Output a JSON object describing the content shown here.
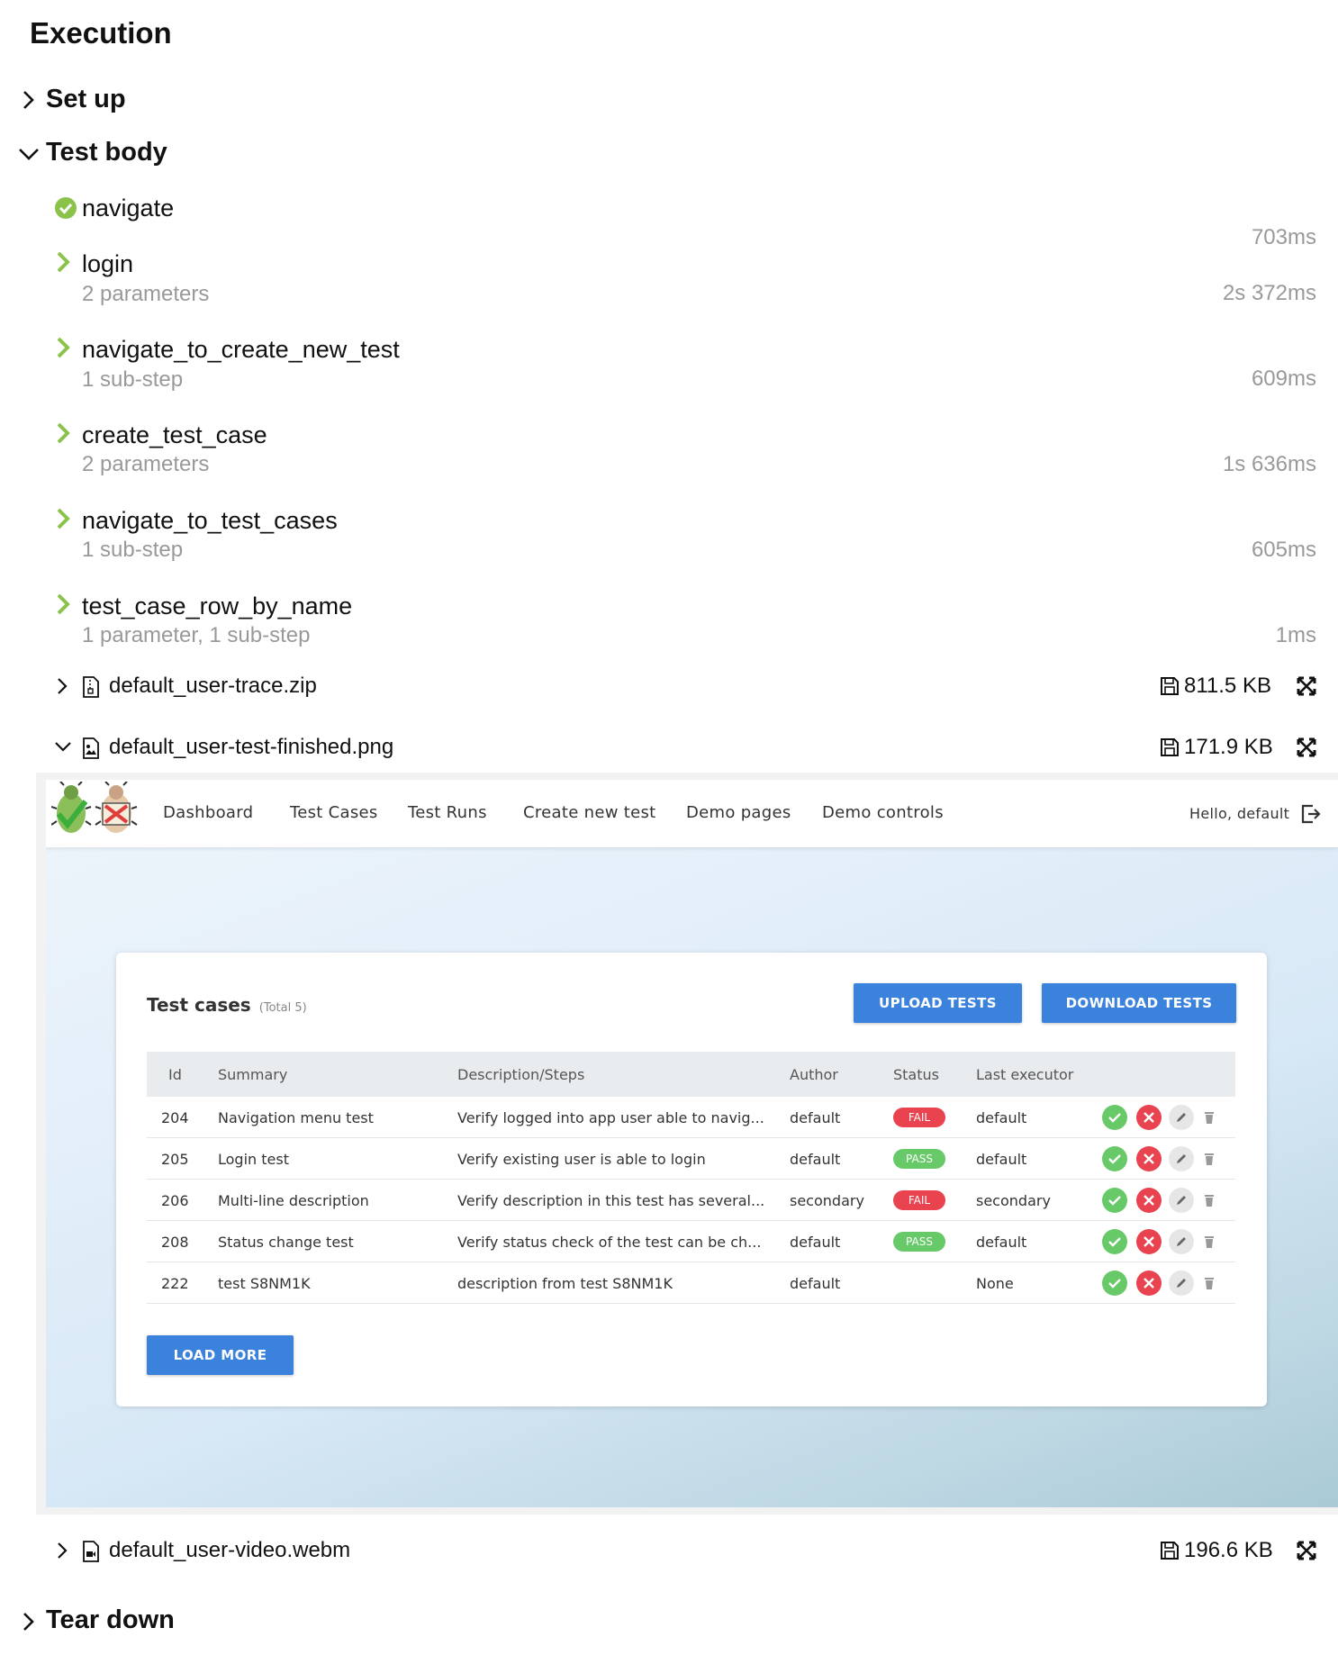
{
  "header": {
    "title": "Execution"
  },
  "sections": {
    "setup": "Set up",
    "body": "Test body",
    "teardown": "Tear down"
  },
  "steps": [
    {
      "title": "navigate",
      "sub": "",
      "duration": "703ms"
    },
    {
      "title": "login",
      "sub": "2 parameters",
      "duration": "2s 372ms"
    },
    {
      "title": "navigate_to_create_new_test",
      "sub": "1 sub-step",
      "duration": "609ms"
    },
    {
      "title": "create_test_case",
      "sub": "2 parameters",
      "duration": "1s 636ms"
    },
    {
      "title": "navigate_to_test_cases",
      "sub": "1 sub-step",
      "duration": "605ms"
    },
    {
      "title": "test_case_row_by_name",
      "sub": "1 parameter, 1 sub-step",
      "duration": "1ms"
    }
  ],
  "attachments": [
    {
      "name": "default_user-trace.zip",
      "size": "811.5 KB"
    },
    {
      "name": "default_user-test-finished.png",
      "size": "171.9 KB"
    },
    {
      "name": "default_user-video.webm",
      "size": "196.6 KB"
    }
  ],
  "screenshot": {
    "nav": {
      "links": [
        "Dashboard",
        "Test Cases",
        "Test Runs",
        "Create new test",
        "Demo pages",
        "Demo controls"
      ],
      "greeting": "Hello, default"
    },
    "card": {
      "title": "Test cases",
      "total": "(Total 5)",
      "upload": "UPLOAD TESTS",
      "download": "DOWNLOAD TESTS",
      "load_more": "LOAD MORE",
      "columns": [
        "Id",
        "Summary",
        "Description/Steps",
        "Author",
        "Status",
        "Last executor"
      ],
      "rows": [
        {
          "id": "204",
          "summary": "Navigation menu test",
          "desc": "Verify logged into app user able to navig...",
          "author": "default",
          "status": "FAIL",
          "executor": "default"
        },
        {
          "id": "205",
          "summary": "Login test",
          "desc": "Verify existing user is able to login",
          "author": "default",
          "status": "PASS",
          "executor": "default"
        },
        {
          "id": "206",
          "summary": "Multi-line description",
          "desc": "Verify description in this test has several...",
          "author": "secondary",
          "status": "FAIL",
          "executor": "secondary"
        },
        {
          "id": "208",
          "summary": "Status change test",
          "desc": "Verify status check of the test can be ch...",
          "author": "default",
          "status": "PASS",
          "executor": "default"
        },
        {
          "id": "222",
          "summary": "test S8NM1K",
          "desc": "description from test S8NM1K",
          "author": "default",
          "status": "",
          "executor": "None"
        }
      ]
    }
  },
  "colors": {
    "pass": "#67c968",
    "fail": "#e8434f",
    "step_chevron": "#8bc34a",
    "button": "#3b82dd"
  }
}
